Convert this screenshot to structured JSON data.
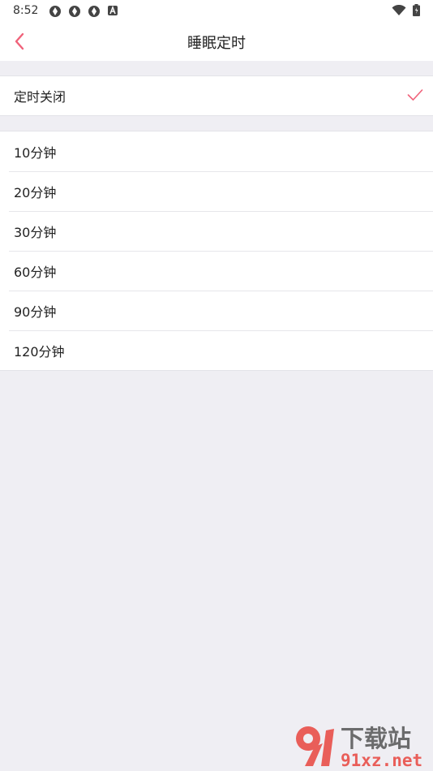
{
  "status_bar": {
    "time": "8:52"
  },
  "header": {
    "title": "睡眠定时"
  },
  "timer_off": {
    "label": "定时关闭",
    "selected": true
  },
  "timer_options": [
    {
      "label": "10分钟"
    },
    {
      "label": "20分钟"
    },
    {
      "label": "30分钟"
    },
    {
      "label": "60分钟"
    },
    {
      "label": "90分钟"
    },
    {
      "label": "120分钟"
    }
  ],
  "watermark": {
    "brand_cn": "下载站",
    "brand_url": "91xz.net"
  },
  "colors": {
    "accent": "#f0627a",
    "background": "#efeef3",
    "card": "#ffffff"
  }
}
